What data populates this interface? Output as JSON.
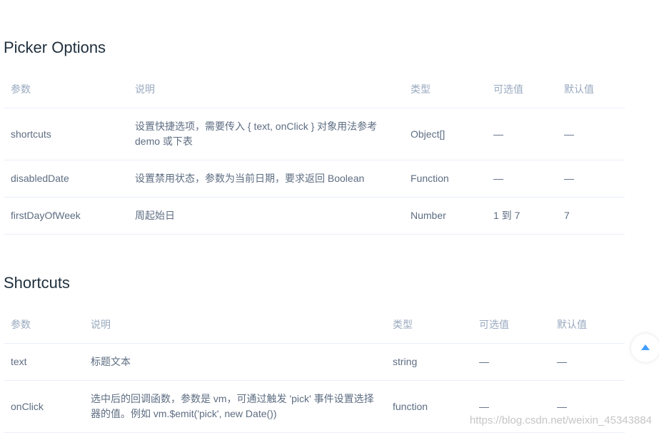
{
  "picker_options": {
    "title": "Picker Options",
    "headers": [
      "参数",
      "说明",
      "类型",
      "可选值",
      "默认值"
    ],
    "rows": [
      {
        "param": "shortcuts",
        "desc": "设置快捷选项，需要传入 { text, onClick } 对象用法参考 demo 或下表",
        "type": "Object[]",
        "options": "—",
        "default": "—"
      },
      {
        "param": "disabledDate",
        "desc": "设置禁用状态，参数为当前日期，要求返回 Boolean",
        "type": "Function",
        "options": "—",
        "default": "—"
      },
      {
        "param": "firstDayOfWeek",
        "desc": "周起始日",
        "type": "Number",
        "options": "1 到 7",
        "default": "7"
      }
    ]
  },
  "shortcuts": {
    "title": "Shortcuts",
    "headers": [
      "参数",
      "说明",
      "类型",
      "可选值",
      "默认值"
    ],
    "rows": [
      {
        "param": "text",
        "desc": "标题文本",
        "type": "string",
        "options": "—",
        "default": "—"
      },
      {
        "param": "onClick",
        "desc": "选中后的回调函数，参数是 vm，可通过触发 'pick' 事件设置选择器的值。例如 vm.$emit('pick', new Date())",
        "type": "function",
        "options": "—",
        "default": "—"
      }
    ]
  },
  "back_to_top": {
    "icon": "caret-up-icon",
    "color": "#409eff"
  },
  "watermark": "https://blog.csdn.net/weixin_45343884"
}
